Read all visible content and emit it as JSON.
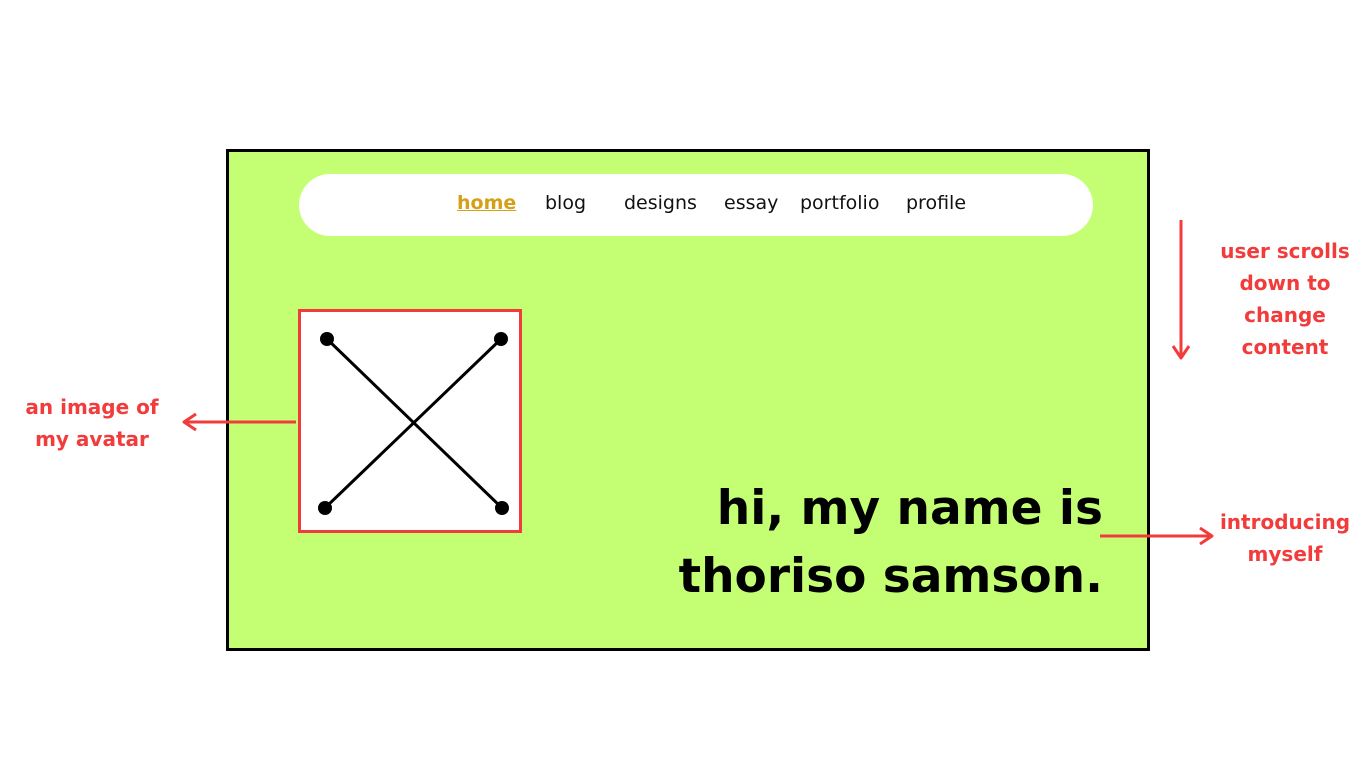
{
  "nav": {
    "items": [
      {
        "label": "home",
        "active": true
      },
      {
        "label": "blog",
        "active": false
      },
      {
        "label": "designs",
        "active": false
      },
      {
        "label": "essay",
        "active": false
      },
      {
        "label": "portfolio",
        "active": false
      },
      {
        "label": "profile",
        "active": false
      }
    ]
  },
  "hero": {
    "line1": "hi, my name is",
    "line2": "thoriso samson."
  },
  "annotations": {
    "avatar_note_line1": "an image of",
    "avatar_note_line2": "my avatar",
    "scroll_note_line1": "user scrolls",
    "scroll_note_line2": "down to",
    "scroll_note_line3": "change",
    "scroll_note_line4": "content",
    "intro_note_line1": "introducing",
    "intro_note_line2": "myself"
  },
  "colors": {
    "page_bg": "#c4ff73",
    "annotation": "#f23b3b",
    "nav_active": "#d4a017"
  },
  "icons": {
    "avatar": "avatar-placeholder-x-icon"
  }
}
